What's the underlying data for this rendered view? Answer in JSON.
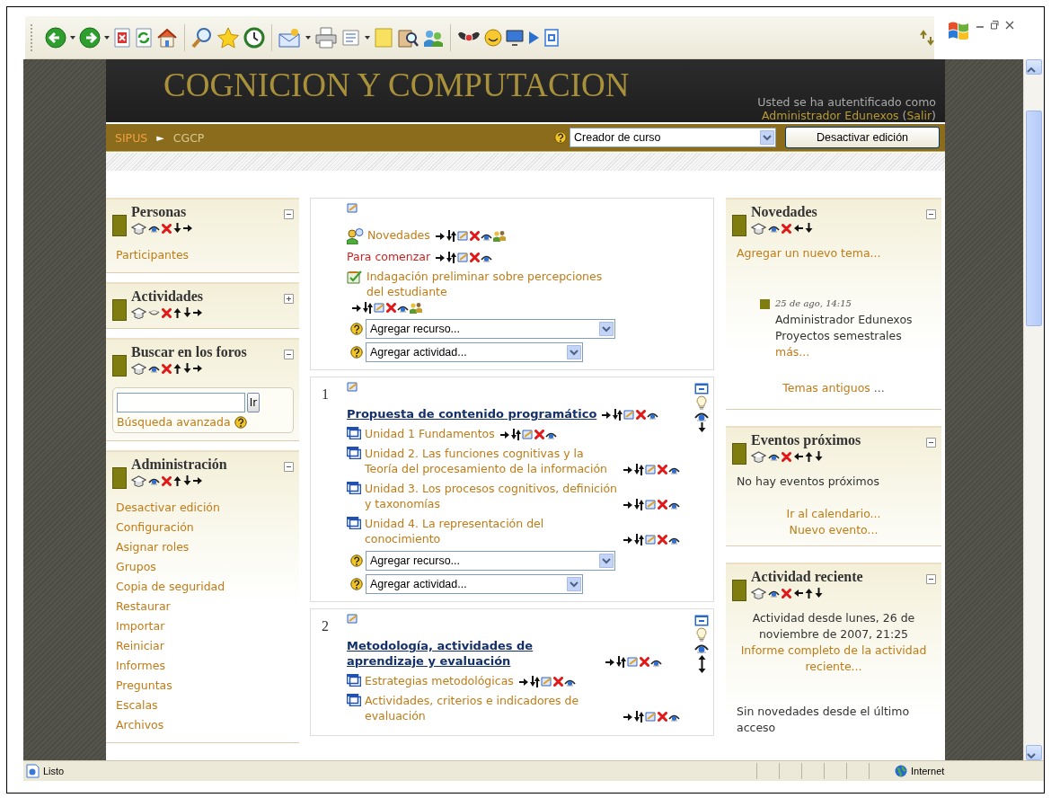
{
  "header": {
    "title": "COGNICION Y COMPUTACION",
    "login": {
      "prefix": "Usted se ha autentificado como ",
      "user": "Administrador Edunexos",
      "open": " (",
      "logout": "Salir",
      "close": ")"
    }
  },
  "navbar": {
    "breadcrumb": [
      {
        "label": "SIPUS"
      },
      {
        "label": "CGCP"
      }
    ],
    "separator": "►",
    "role_select": "Creador de curso",
    "edit_button": "Desactivar edición"
  },
  "left_blocks": [
    {
      "title": "Personas",
      "kind": "links",
      "visible": true,
      "collapsed": false,
      "links": [
        "Participantes"
      ]
    },
    {
      "title": "Actividades",
      "visible": false,
      "collapsed": true
    },
    {
      "title": "Buscar en los foros",
      "kind": "search",
      "visible": true,
      "collapsed": false,
      "search": {
        "button": "Ir",
        "advanced": "Búsqueda avanzada"
      }
    },
    {
      "title": "Administración",
      "kind": "links",
      "visible": true,
      "collapsed": false,
      "links": [
        "Desactivar edición",
        "Configuración",
        "Asignar roles",
        "Grupos",
        "Copia de seguridad",
        "Restaurar",
        "Importar",
        "Reiniciar",
        "Informes",
        "Preguntas",
        "Escalas",
        "Archivos"
      ]
    }
  ],
  "sections": [
    {
      "activities": [
        {
          "kind": "forum",
          "name": "Novedades",
          "groups": true
        },
        {
          "kind": "label",
          "name": "Para comenzar",
          "groups": false
        },
        {
          "kind": "choice",
          "name": "Indagación preliminar sobre percepciones del estudiante",
          "groups": true
        }
      ],
      "add_resource": "Agregar recurso...",
      "add_activity": "Agregar actividad..."
    },
    {
      "number": "1",
      "activities": [
        {
          "kind": "heading",
          "name": "Propuesta de contenido programático",
          "groups": false
        },
        {
          "kind": "resource",
          "name": "Unidad 1 Fundamentos",
          "groups": false
        },
        {
          "kind": "resource",
          "name": "Unidad 2. Las funciones cognitivas y la Teoría del procesamiento de la información",
          "groups": false
        },
        {
          "kind": "resource",
          "name": "Unidad 3. Los procesos cognitivos, definición y taxonomías",
          "groups": false
        },
        {
          "kind": "resource",
          "name": "Unidad 4. La representación del conocimiento",
          "groups": false
        }
      ],
      "add_resource": "Agregar recurso...",
      "add_activity": "Agregar actividad..."
    },
    {
      "number": "2",
      "activities": [
        {
          "kind": "heading",
          "name": "Metodología, actividades de aprendizaje y evaluación",
          "groups": false
        },
        {
          "kind": "resource",
          "name": "Estrategias metodológicas",
          "groups": false
        },
        {
          "kind": "resource",
          "name": "Actividades, criterios e indicadores de evaluación",
          "groups": false
        }
      ]
    }
  ],
  "right_blocks": [
    {
      "title": "Novedades",
      "kind": "news",
      "visible": true,
      "collapsed": false,
      "add_link": "Agregar un nuevo tema...",
      "posts": [
        {
          "date": "25 de ago, 14:15",
          "author": "Administrador Edunexos",
          "subject": "Proyectos semestrales",
          "more": "más..."
        }
      ],
      "older": {
        "link": "Temas antiguos",
        "suffix": " ..."
      }
    },
    {
      "title": "Eventos próximos",
      "kind": "events",
      "visible": true,
      "collapsed": false,
      "message": "No hay eventos próximos",
      "links": [
        "Ir al calendario...",
        "Nuevo evento..."
      ]
    },
    {
      "title": "Actividad reciente",
      "kind": "recent",
      "visible": true,
      "collapsed": false,
      "since": "Actividad desde lunes, 26 de noviembre de 2007, 21:25",
      "report": "Informe completo de la actividad reciente...",
      "note": "Sin novedades desde el último acceso"
    }
  ],
  "status_bar": {
    "text": "Listo",
    "zone": "Internet"
  }
}
